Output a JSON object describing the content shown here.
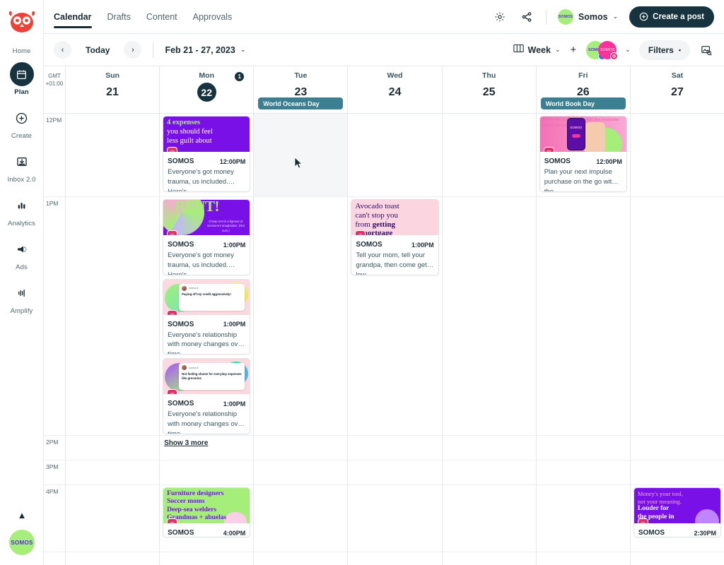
{
  "brand": {
    "logo_icon": "owl-logo",
    "colors": {
      "accent_dark": "#16333f",
      "brand_red": "#ec4339",
      "occasion": "#3d7f92",
      "avatar_green": "#a6ee7a",
      "avatar_pink": "#f9319c"
    }
  },
  "sidebar": {
    "items": [
      {
        "label": "Home",
        "icon": "home-icon",
        "active": false
      },
      {
        "label": "Plan",
        "icon": "calendar-icon",
        "active": true
      },
      {
        "label": "Create",
        "icon": "plus-circle-icon",
        "active": false
      },
      {
        "label": "Inbox 2.0",
        "icon": "inbox-icon",
        "active": false
      },
      {
        "label": "Analytics",
        "icon": "bar-chart-icon",
        "active": false
      },
      {
        "label": "Ads",
        "icon": "megaphone-icon",
        "active": false
      },
      {
        "label": "Amplify",
        "icon": "amplify-icon",
        "active": false
      }
    ],
    "collapse_icon": "chevron-up-icon",
    "avatar_label": "SOMOS"
  },
  "topbar": {
    "tabs": [
      {
        "label": "Calendar",
        "active": true
      },
      {
        "label": "Drafts",
        "active": false
      },
      {
        "label": "Content",
        "active": false
      },
      {
        "label": "Approvals",
        "active": false
      }
    ],
    "settings_icon": "gear-icon",
    "share_icon": "share-icon",
    "account": {
      "avatar_label": "SOMOS",
      "name": "Somos",
      "caret": "⌄"
    },
    "create_post_label": "Create a post"
  },
  "subbar": {
    "prev_label": "‹",
    "today_label": "Today",
    "next_label": "›",
    "date_range": "Feb 21 - 27, 2023",
    "date_caret": "⌄",
    "view": {
      "icon": "week-view-icon",
      "label": "Week",
      "caret": "⌄"
    },
    "add_label": "+",
    "profiles": [
      {
        "label": "SOMOS",
        "network": "facebook",
        "color": "#a6ee7a"
      },
      {
        "label": "SOMOS",
        "network": "instagram",
        "color": "#f9319c"
      }
    ],
    "profiles_caret": "⌄",
    "filters_label": "Filters",
    "filters_caret": "•",
    "export_icon": "image-export-icon"
  },
  "calendar": {
    "timezone": {
      "line1": "GMT",
      "line2": "+01:00"
    },
    "days": [
      {
        "name": "Sun",
        "num": "21",
        "today": false,
        "badge": null,
        "occasion": null
      },
      {
        "name": "Mon",
        "num": "22",
        "today": true,
        "badge": "1",
        "occasion": null
      },
      {
        "name": "Tue",
        "num": "23",
        "today": false,
        "badge": null,
        "occasion": "World Oceans Day"
      },
      {
        "name": "Wed",
        "num": "24",
        "today": false,
        "badge": null,
        "occasion": null
      },
      {
        "name": "Thu",
        "num": "25",
        "today": false,
        "badge": null,
        "occasion": null
      },
      {
        "name": "Fri",
        "num": "26",
        "today": false,
        "badge": null,
        "occasion": "World Book Day"
      },
      {
        "name": "Sat",
        "num": "27",
        "today": false,
        "badge": null,
        "occasion": null
      }
    ],
    "time_slots": [
      "12PM",
      "1PM",
      "2PM",
      "3PM",
      "4PM"
    ],
    "show_more_label": "Show 3 more",
    "posts": {
      "mon_12pm": {
        "brand": "SOMOS",
        "time": "12:00PM",
        "network": "instagram",
        "text": "Everyone's got money trauma, us included. Here's...",
        "art_line1": "4 expenses",
        "art_line2": "you should feel",
        "art_line3": "less guilt about"
      },
      "mon_1pm_a": {
        "brand": "SOMOS",
        "time": "1:00PM",
        "network": "instagram",
        "text": "Everyone's got money trauma, us included. Here's...",
        "art_word": "RENT!",
        "art_sub": "Cheap rent is a figment of someone's imagination. (Not ours.)"
      },
      "mon_1pm_b": {
        "brand": "SOMOS",
        "time": "1:00PM",
        "network": "instagram",
        "text": "Everyone's relationship with money changes over time....",
        "tweet_handle": "somos.it",
        "tweet_body": "Paying off my credit aggressively!"
      },
      "mon_1pm_c": {
        "brand": "SOMOS",
        "time": "1:00PM",
        "network": "instagram",
        "text": "Everyone's relationship with money changes over time....",
        "tweet_handle": "somos.it",
        "tweet_body": "Not feeling shame for everyday expenses like groceries"
      },
      "wed_1pm": {
        "brand": "SOMOS",
        "time": "1:00PM",
        "network": "instagram",
        "text": "Tell your mom, tell your grandpa, then come get low...",
        "art_line1": "Avocado toast",
        "art_line2": "can't stop you",
        "art_line3": "from ",
        "art_line3_bold": "getting",
        "art_line4": "a mortgage"
      },
      "fri_12pm": {
        "brand": "SOMOS",
        "time": "12:00PM",
        "network": "instagram",
        "text": "Plan your next impulse purchase on the go with the...",
        "art_bg_words": "Better for everyone Better for everyone Better for everyone Better for",
        "phone_label": "SOMOS"
      },
      "mon_4pm": {
        "brand": "SOMOS",
        "time": "4:00PM",
        "network": "instagram",
        "art_line1": "Furniture designers",
        "art_line2": "Soccer moms",
        "art_line3": "Deep-sea welders",
        "art_line4": "Grandmas + abuelas"
      },
      "sat_4pm": {
        "brand": "SOMOS",
        "time": "2:30PM",
        "network": "instagram",
        "art_line1": "Money's your tool,",
        "art_line2": "not your meaning.",
        "art_line3": "Louder for",
        "art_line4": "the people in"
      }
    }
  }
}
